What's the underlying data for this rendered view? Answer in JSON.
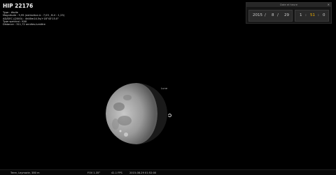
{
  "object_info": {
    "name": "HIP 22176",
    "type_line": "Type : étoile",
    "magnitude_line": "Magnitude : 5,95 (extinction à : 7,03 , B-V : 1,23)",
    "coords_line": "AD/DEC (J2000) : 4h46m14.5s/+18°43'15.0\"",
    "spectral_line": "Type spectral : K4II",
    "distance_line": "Distance : 311,72 années-lumière"
  },
  "datetime_panel": {
    "title": "Date et heure",
    "close_icon": "close-icon",
    "year": "2015",
    "sep1": "/",
    "month": "8",
    "sep2": "/",
    "day": "29",
    "hour": "1",
    "colon1": ":",
    "minute": "51",
    "colon2": ":",
    "second": "0"
  },
  "sky": {
    "moon_label": "Lune"
  },
  "status_bar": {
    "location": "Terre, Leymarie, 380 m",
    "fov": "FOV 1.35°",
    "fps": "41.1 FPS",
    "datetime": "2015-08-29  01:52:00"
  }
}
